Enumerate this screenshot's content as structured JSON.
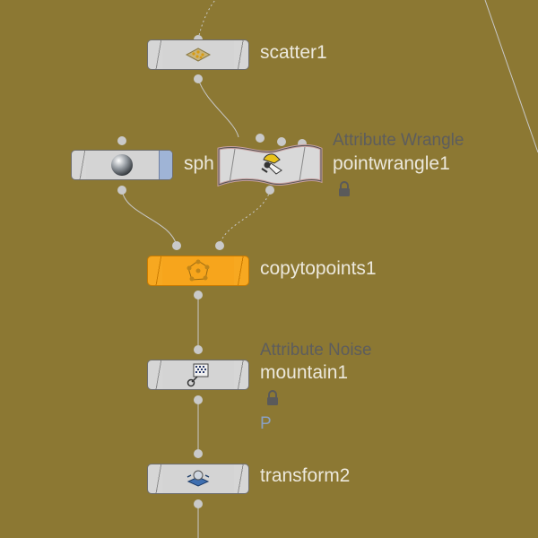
{
  "nodes": {
    "scatter": {
      "name": "scatter1"
    },
    "sphere": {
      "name_partial": "sph"
    },
    "pointwrangle": {
      "type": "Attribute Wrangle",
      "name": "pointwrangle1"
    },
    "copytopoints": {
      "name": "copytopoints1"
    },
    "mountain": {
      "type": "Attribute Noise",
      "name": "mountain1",
      "attrib_label": "P"
    },
    "transform": {
      "name": "transform2"
    }
  },
  "colors": {
    "background": "#8c7833",
    "node_gray": "#d4d4d4",
    "node_selected": "#f7a51c",
    "label_text": "#ece8dc",
    "type_text": "#5d5d5d",
    "attrib_text": "#8aa0c2"
  },
  "icons": {
    "scatter": "scatter-icon",
    "sphere": "sphere-icon",
    "pointwrangle": "wrangle-icon",
    "copytopoints": "copy-to-points-icon",
    "mountain": "noise-icon",
    "transform": "transform-icon",
    "lock": "lock-icon"
  }
}
